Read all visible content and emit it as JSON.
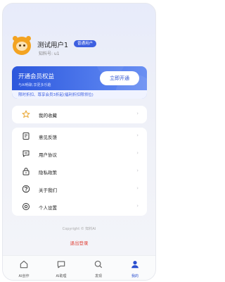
{
  "profile": {
    "name": "测试用户1",
    "badge": "普通用户",
    "id_text": "知料号: u1"
  },
  "vip": {
    "title": "开通会员权益",
    "subtitle": "与AI畅聊,享更多乐趣",
    "button": "立即开通",
    "benefits": "限时折扣、尊享会员3折起(福利折扣限领位)"
  },
  "menu": {
    "favorites": {
      "label": "我的收藏",
      "icon": "star-icon"
    },
    "items": [
      {
        "label": "意见反馈",
        "icon": "feedback-icon"
      },
      {
        "label": "用户协议",
        "icon": "agreement-icon"
      },
      {
        "label": "隐私政策",
        "icon": "lock-icon"
      },
      {
        "label": "关于我们",
        "icon": "help-icon"
      },
      {
        "label": "个人设置",
        "icon": "settings-icon"
      }
    ]
  },
  "footer": {
    "copyright": "Copyright © 知料AI",
    "logout": "退出登录"
  },
  "tabs": [
    {
      "label": "AI创作",
      "icon": "home-icon",
      "active": false
    },
    {
      "label": "AI助理",
      "icon": "chat-icon",
      "active": false
    },
    {
      "label": "发现",
      "icon": "search-icon",
      "active": false
    },
    {
      "label": "我的",
      "icon": "user-icon",
      "active": true
    }
  ],
  "colors": {
    "accent": "#2a4fcf",
    "logout": "#e0443a",
    "favorite_star": "#e9a52e"
  }
}
